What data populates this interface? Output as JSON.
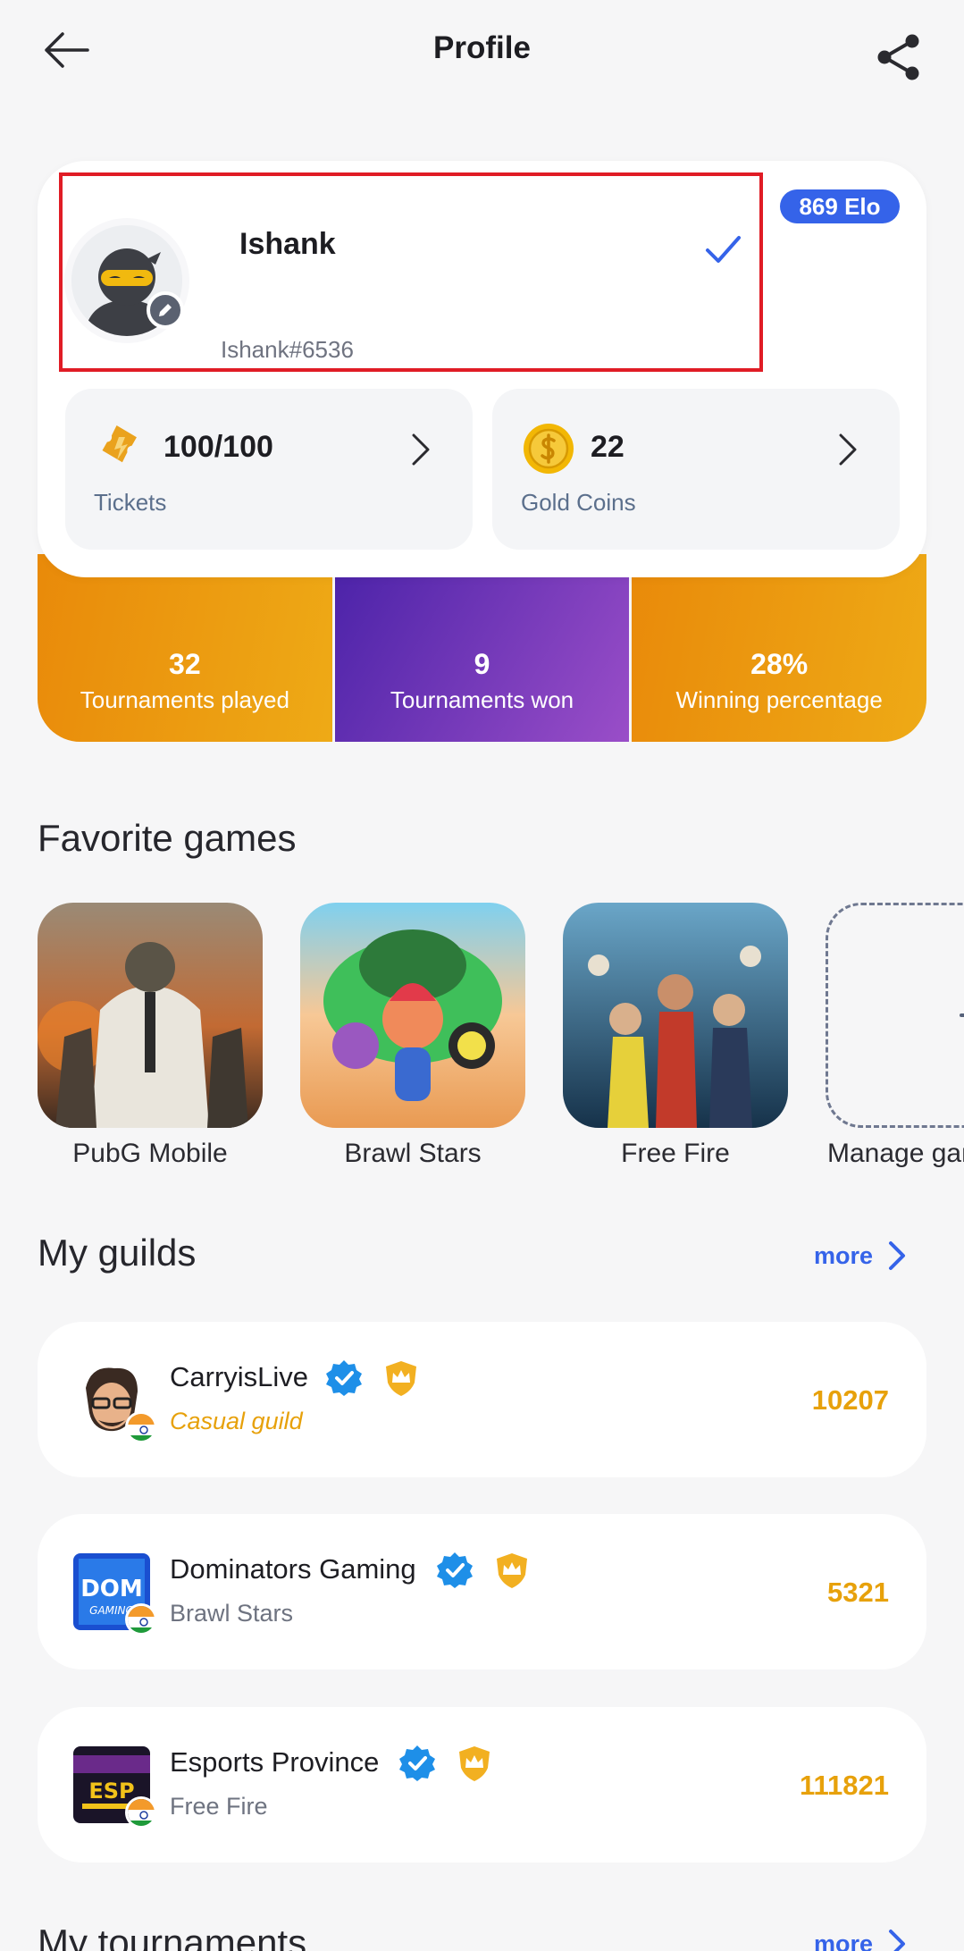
{
  "header": {
    "title": "Profile",
    "back_icon": "arrow-left-icon",
    "share_icon": "share-icon"
  },
  "profile": {
    "username": "Ishank",
    "tag": "Ishank#6536",
    "elo": "869 Elo"
  },
  "balances": {
    "tickets": {
      "value": "100/100",
      "label": "Tickets"
    },
    "coins": {
      "value": "22",
      "label": "Gold Coins"
    }
  },
  "stats": [
    {
      "value": "32",
      "label": "Tournaments played"
    },
    {
      "value": "9",
      "label": "Tournaments won"
    },
    {
      "value": "28%",
      "label": "Winning percentage"
    }
  ],
  "favorite_games": {
    "title": "Favorite games",
    "games": [
      {
        "name": "PubG Mobile"
      },
      {
        "name": "Brawl Stars"
      },
      {
        "name": "Free Fire"
      }
    ],
    "manage_label": "Manage games"
  },
  "guilds": {
    "title": "My guilds",
    "more_label": "more",
    "items": [
      {
        "name": "CarryisLive",
        "subtitle": "Casual guild",
        "score": "10207"
      },
      {
        "name": "Dominators Gaming",
        "subtitle": "Brawl Stars",
        "score": "5321"
      },
      {
        "name": "Esports Province",
        "subtitle": "Free Fire",
        "score": "111821"
      }
    ]
  },
  "tournaments": {
    "title": "My tournaments",
    "more_label": "more"
  },
  "colors": {
    "accent": "#3563e9",
    "gold": "#e7a10b",
    "highlight": "#e01c25"
  }
}
